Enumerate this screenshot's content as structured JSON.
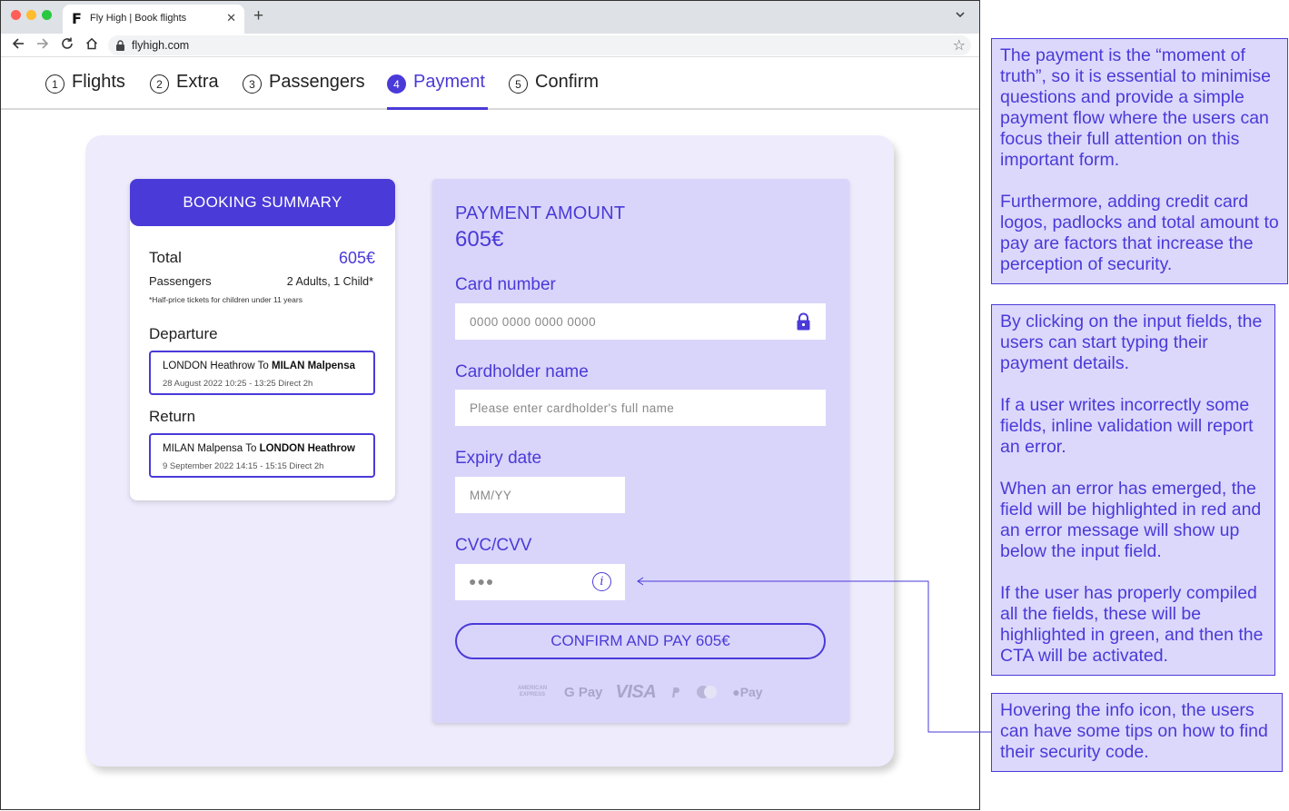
{
  "browser": {
    "tab_logo": "F",
    "tab_title": "Fly High | Book flights",
    "tab_close": "✕",
    "new_tab": "+",
    "url": "flyhigh.com",
    "star": "☆"
  },
  "steps": [
    {
      "num": "1",
      "label": "Flights",
      "active": false
    },
    {
      "num": "2",
      "label": "Extra",
      "active": false
    },
    {
      "num": "3",
      "label": "Passengers",
      "active": false
    },
    {
      "num": "4",
      "label": "Payment",
      "active": true
    },
    {
      "num": "5",
      "label": "Confirm",
      "active": false
    }
  ],
  "summary": {
    "title": "BOOKING SUMMARY",
    "total_label": "Total",
    "total_value": "605€",
    "passengers_label": "Passengers",
    "passengers_value": "2 Adults, 1 Child*",
    "note": "*Half-price tickets for children under 11 years",
    "departure_label": "Departure",
    "departure": {
      "from": "LONDON Heathrow",
      "to_word": "To",
      "to": "MILAN Malpensa",
      "info": "28 August 2022  10:25 - 13:25  Direct 2h"
    },
    "return_label": "Return",
    "return": {
      "from": "MILAN Malpensa",
      "to_word": "To",
      "to": "LONDON Heathrow",
      "info": "9 September 2022  14:15 - 15:15  Direct 2h"
    }
  },
  "payment": {
    "title": "PAYMENT AMOUNT",
    "amount": "605€",
    "card_number_label": "Card number",
    "card_number_placeholder": "0000 0000 0000 0000",
    "cardholder_label": "Cardholder name",
    "cardholder_placeholder": "Please enter cardholder's full name",
    "expiry_label": "Expiry date",
    "expiry_placeholder": "MM/YY",
    "cvc_label": "CVC/CVV",
    "cvc_value": "●●●",
    "info_icon": "i",
    "confirm_button": "CONFIRM AND PAY 605€",
    "logos": {
      "amex_line1": "AMERICAN",
      "amex_line2": "EXPRESS",
      "gpay": "G Pay",
      "visa": "VISA",
      "apay": "Pay"
    }
  },
  "notes": {
    "note1_p1": "The payment is the “moment of truth”, so it is essential to minimise questions and provide a simple payment flow where the users can focus their full attention on this important form.",
    "note1_p2": "Furthermore, adding credit card logos, padlocks and total amount to pay are factors that increase the perception of security.",
    "note2_p1": "By clicking on the input fields, the users can start typing their payment details.",
    "note2_p2": "If a user writes incorrectly some fields, inline validation will report an error.",
    "note2_p3": "When an error has emerged, the field will be highlighted in red and an error message will show up below the input field.",
    "note2_p4": "If the user has properly compiled all the fields, these will be highlighted in green, and then the CTA will be activated.",
    "note3_p1": "Hovering the info icon, the users can have some tips on how to find their security code."
  },
  "colors": {
    "accent": "#4a3ad8",
    "panel": "#d9d5fa",
    "card_bg": "#eeebfc"
  }
}
